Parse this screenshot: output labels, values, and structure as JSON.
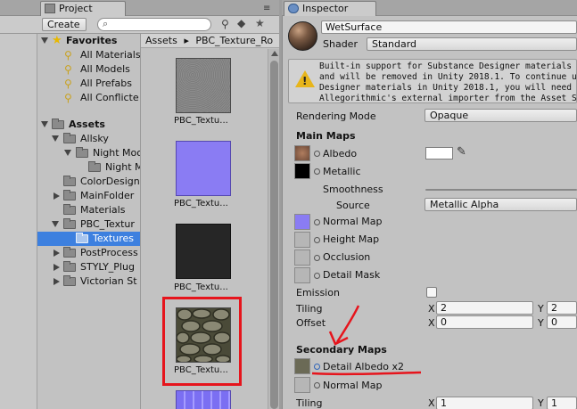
{
  "project_tab": {
    "label": "Project"
  },
  "inspector_tab": {
    "label": "Inspector"
  },
  "project_toolbar": {
    "create_label": "Create ▾",
    "search_placeholder": ""
  },
  "tree": {
    "favorites": {
      "label": "Favorites",
      "items": [
        "All Materials",
        "All Models",
        "All Prefabs",
        "All Conflicte"
      ]
    },
    "assets": {
      "label": "Assets"
    },
    "folders": [
      {
        "label": "Allsky"
      },
      {
        "label": "Night Moo"
      },
      {
        "label": "Night M"
      },
      {
        "label": "ColorDesign"
      },
      {
        "label": "MainFolder"
      },
      {
        "label": "Materials"
      },
      {
        "label": "PBC_Textur"
      },
      {
        "label": "Textures"
      },
      {
        "label": "PostProcess"
      },
      {
        "label": "STYLY_Plug"
      },
      {
        "label": "Victorian St"
      }
    ]
  },
  "breadcrumb": {
    "root": "Assets",
    "sep": "▸",
    "current": "PBC_Texture_Ro"
  },
  "grid": {
    "items": [
      {
        "label": "PBC_Textu..."
      },
      {
        "label": "PBC_Textu..."
      },
      {
        "label": "PBC_Textu..."
      },
      {
        "label": "PBC_Textu..."
      }
    ]
  },
  "inspector": {
    "material_name": "WetSurface",
    "shader_label": "Shader",
    "shader_value": "Standard",
    "help_text": "Built-in support for Substance Designer materials has bee\nand will be removed in Unity 2018.1. To continue using Su\nDesigner materials in Unity 2018.1, you will need to insta\nAllegorithmic's external importer from the Asset Store.",
    "rendering_mode_label": "Rendering Mode",
    "rendering_mode_value": "Opaque",
    "main_maps_header": "Main Maps",
    "albedo_label": "Albedo",
    "metallic_label": "Metallic",
    "smoothness_label": "Smoothness",
    "source_label": "Source",
    "source_value": "Metallic Alpha",
    "normal_map_label": "Normal Map",
    "height_map_label": "Height Map",
    "occlusion_label": "Occlusion",
    "detail_mask_label": "Detail Mask",
    "emission_label": "Emission",
    "tiling_label": "Tiling",
    "offset_label": "Offset",
    "tiling_x": "2",
    "tiling_y": "2",
    "offset_x": "0",
    "offset_y": "0",
    "x_label": "X",
    "y_label": "Y",
    "secondary_maps_header": "Secondary Maps",
    "detail_albedo_label": "Detail Albedo x2",
    "secondary_normal_label": "Normal Map",
    "secondary_tiling_label": "Tiling",
    "secondary_tiling_x": "1",
    "secondary_tiling_y": "1"
  },
  "colors": {
    "selection": "#3d80df",
    "annotation_red": "#e6141c"
  }
}
